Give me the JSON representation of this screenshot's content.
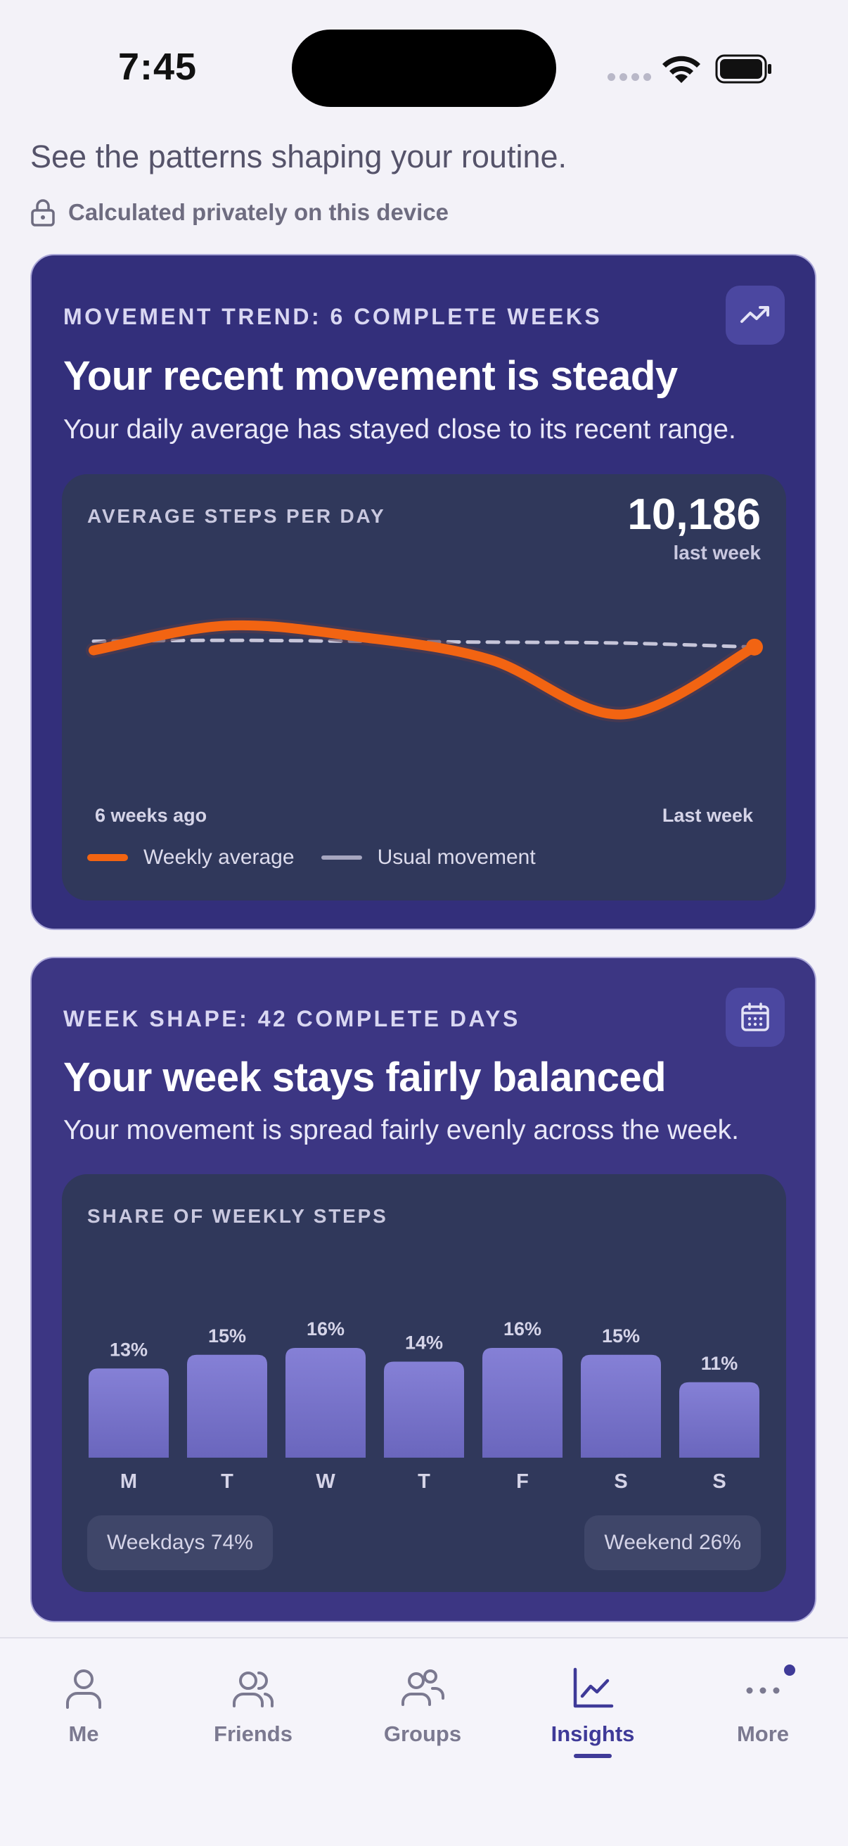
{
  "status_bar": {
    "time": "7:45"
  },
  "header": {
    "subtitle": "See the patterns shaping your routine.",
    "privacy_note": "Calculated privately on this device"
  },
  "movement_card": {
    "kicker": "MOVEMENT TREND: 6 COMPLETE WEEKS",
    "title": "Your recent movement is steady",
    "description": "Your daily average has stayed close to its recent range.",
    "badge_icon": "trend-up-icon",
    "panel_label": "AVERAGE STEPS PER DAY",
    "big_value": "10,186",
    "big_value_caption": "last week",
    "axis_start": "6 weeks ago",
    "axis_end": "Last week",
    "legend": [
      "Weekly average",
      "Usual movement"
    ],
    "colors": {
      "weekly": "#f26412",
      "usual": "#c6c5d9"
    }
  },
  "week_card": {
    "kicker": "WEEK SHAPE: 42 COMPLETE DAYS",
    "title": "Your week stays fairly balanced",
    "description": "Your movement is spread fairly evenly across the week.",
    "badge_icon": "calendar-icon",
    "panel_label": "SHARE OF WEEKLY STEPS",
    "weekdays_pill": "Weekdays 74%",
    "weekend_pill": "Weekend 26%",
    "bar_color": "#7a76cc"
  },
  "chart_data": [
    {
      "type": "line",
      "x": [
        "6 weeks ago",
        "",
        "",
        "",
        "",
        "Last week"
      ],
      "series": [
        {
          "name": "Weekly average",
          "values": [
            10150,
            10420,
            10300,
            10050,
            9450,
            10186
          ]
        },
        {
          "name": "Usual movement",
          "values": [
            10250,
            10260,
            10250,
            10240,
            10230,
            10186
          ]
        }
      ],
      "ylabel": "AVERAGE STEPS PER DAY",
      "ylim": [
        9000,
        11000
      ],
      "grid": false,
      "legend": "bottom-left"
    },
    {
      "type": "bar",
      "categories": [
        "M",
        "T",
        "W",
        "T",
        "F",
        "S",
        "S"
      ],
      "values": [
        13,
        15,
        16,
        14,
        16,
        15,
        11
      ],
      "labels": [
        "13%",
        "15%",
        "16%",
        "14%",
        "16%",
        "15%",
        "11%"
      ],
      "title": "SHARE OF WEEKLY STEPS",
      "ylim": [
        0,
        16
      ],
      "grid": false
    }
  ],
  "bottom_nav": {
    "items": [
      {
        "label": "Me",
        "icon": "person-icon"
      },
      {
        "label": "Friends",
        "icon": "friends-icon"
      },
      {
        "label": "Groups",
        "icon": "groups-icon"
      },
      {
        "label": "Insights",
        "icon": "insights-chart-icon",
        "active": true
      },
      {
        "label": "More",
        "icon": "more-dots-icon"
      }
    ]
  }
}
